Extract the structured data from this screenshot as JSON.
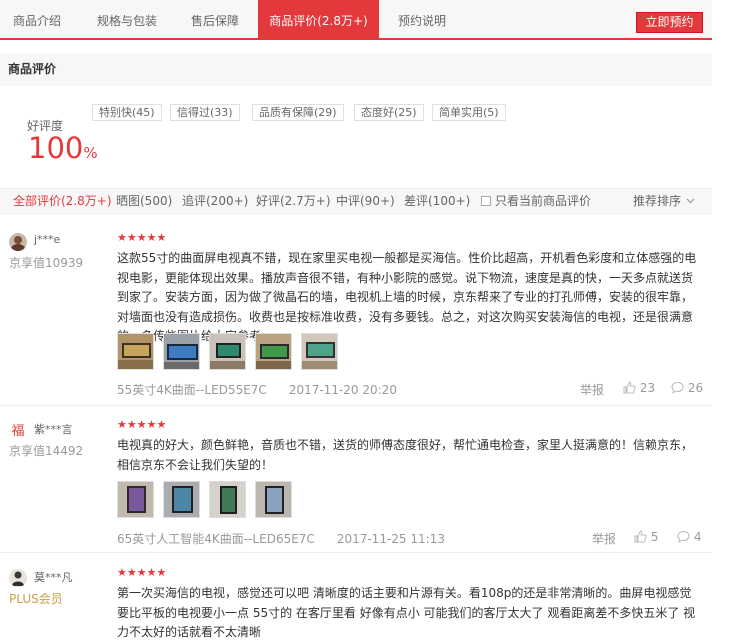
{
  "tabs": [
    "商品介绍",
    "规格与包装",
    "售后保障",
    "商品评价(2.8万+)",
    "预约说明"
  ],
  "active_tab": 3,
  "reserve_label": "立即预约",
  "section_title": "商品评价",
  "rating": {
    "label": "好评度",
    "value": "100",
    "unit": "%"
  },
  "tags": [
    "特别快(45)",
    "信得过(33)",
    "品质有保障(29)",
    "态度好(25)",
    "简单实用(5)"
  ],
  "filters": [
    "全部评价(2.8万+)",
    "晒图(500)",
    "追评(200+)",
    "好评(2.7万+)",
    "中评(90+)",
    "差评(100+)"
  ],
  "only_current_label": "只看当前商品评价",
  "sort_label": "推荐排序",
  "stars_glyph": "★★★★★",
  "report_label": "举报",
  "colors": {
    "accent": "#e4393c",
    "tab_bg": "#f7f7f7",
    "plus": "#c8a248"
  },
  "reviews": [
    {
      "user": "j***e",
      "level": "京享值10939",
      "stars": 5,
      "text": "这款55寸的曲面屏电视真不错，现在家里买电视一般都是买海信。性价比超高，开机看色彩度和立体感强的电视电影，更能体现出效果。播放声音很不错，有种小影院的感觉。说下物流，速度是真的快，一天多点就送货到家了。安装方面，因为做了微晶石的墙，电视机上墙的时候，京东帮来了专业的打孔师傅，安装的很牢靠，对墙面也没有造成损伤。收费也是按标准收费，没有多要钱。总之，对这次购买安装海信的电视，还是很满意的。多传些图片给大家参考",
      "product": "55英寸4K曲面--LED55E7C",
      "date": "2017-11-20 20:20",
      "likes": "23",
      "comments": "26"
    },
    {
      "user": "紫***言",
      "level": "京享值14492",
      "stars": 5,
      "text": "电视真的好大，颜色鲜艳，音质也不错，送货的师傅态度很好，帮忙通电检查，家里人挺满意的！信赖京东，相信京东不会让我们失望的！",
      "product": "65英寸人工智能4K曲面--LED65E7C",
      "date": "2017-11-25 11:13",
      "likes": "5",
      "comments": "4"
    },
    {
      "user": "莫***凡",
      "level": "PLUS会员",
      "stars": 5,
      "text": "第一次买海信的电视，感觉还可以吧 清晰度的话主要和片源有关。看108p的还是非常清晰的。曲屏电视感觉要比平板的电视要小一点 55寸的 在客厅里看 好像有点小 可能我们的客厅太大了 观看距离差不多快五米了 视力不太好的话就看不太清晰"
    }
  ]
}
